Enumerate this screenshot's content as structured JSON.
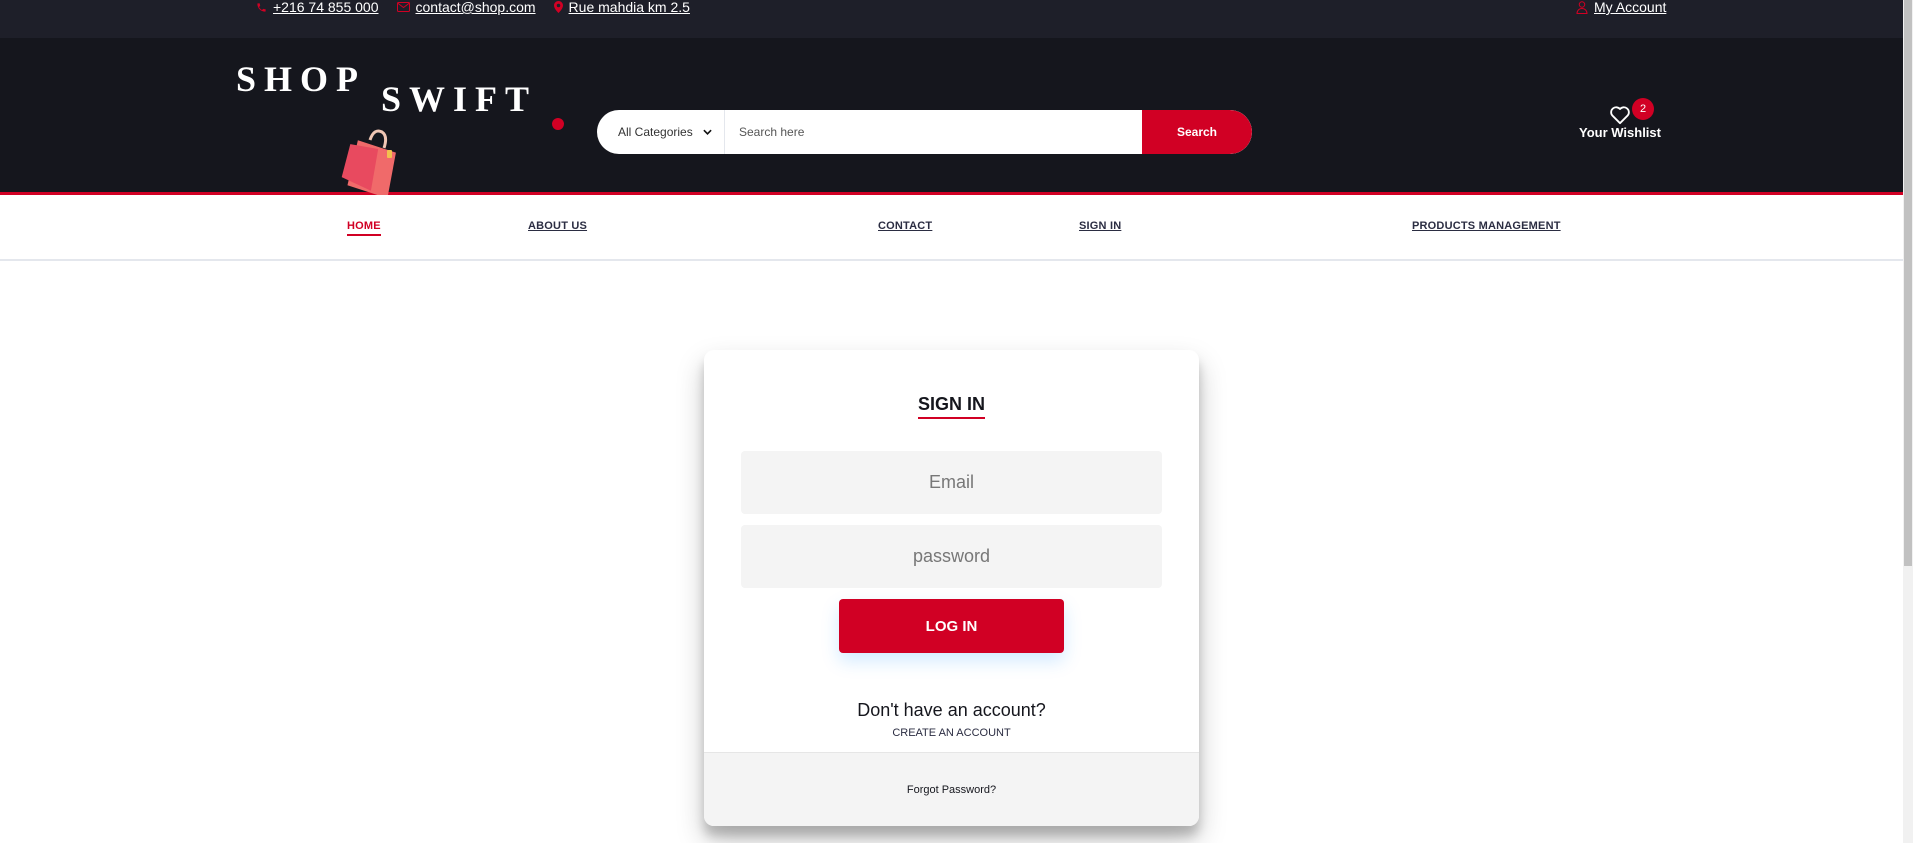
{
  "topbar": {
    "phone": "+216 74 855 000",
    "email": "contact@shop.com",
    "address": "Rue mahdia km 2.5",
    "account": "My Account",
    "icons": [
      "phone-icon",
      "envelope-icon",
      "map-marker-icon",
      "user-icon"
    ]
  },
  "header": {
    "logo_word1": "SHOP",
    "logo_word2": "SWIFT",
    "category_selected": "All Categories",
    "search_placeholder": "Search here",
    "search_button": "Search",
    "wishlist_label": "Your Wishlist",
    "wishlist_count": "2"
  },
  "nav": {
    "items": [
      "HOME",
      "ABOUT US",
      "CONTACT",
      "SIGN IN",
      "PRODUCTS MANAGEMENT"
    ],
    "active": "HOME"
  },
  "signin": {
    "title": "SIGN IN",
    "email_placeholder": "Email",
    "password_placeholder": "password",
    "login_button": "LOG IN",
    "no_account": "Don't have an account?",
    "create_account": "CREATE AN ACCOUNT",
    "forgot_password": "Forgot Password?"
  },
  "colors": {
    "accent": "#d10024",
    "header_bg": "#15161d",
    "topbar_bg": "#1e1f29"
  }
}
